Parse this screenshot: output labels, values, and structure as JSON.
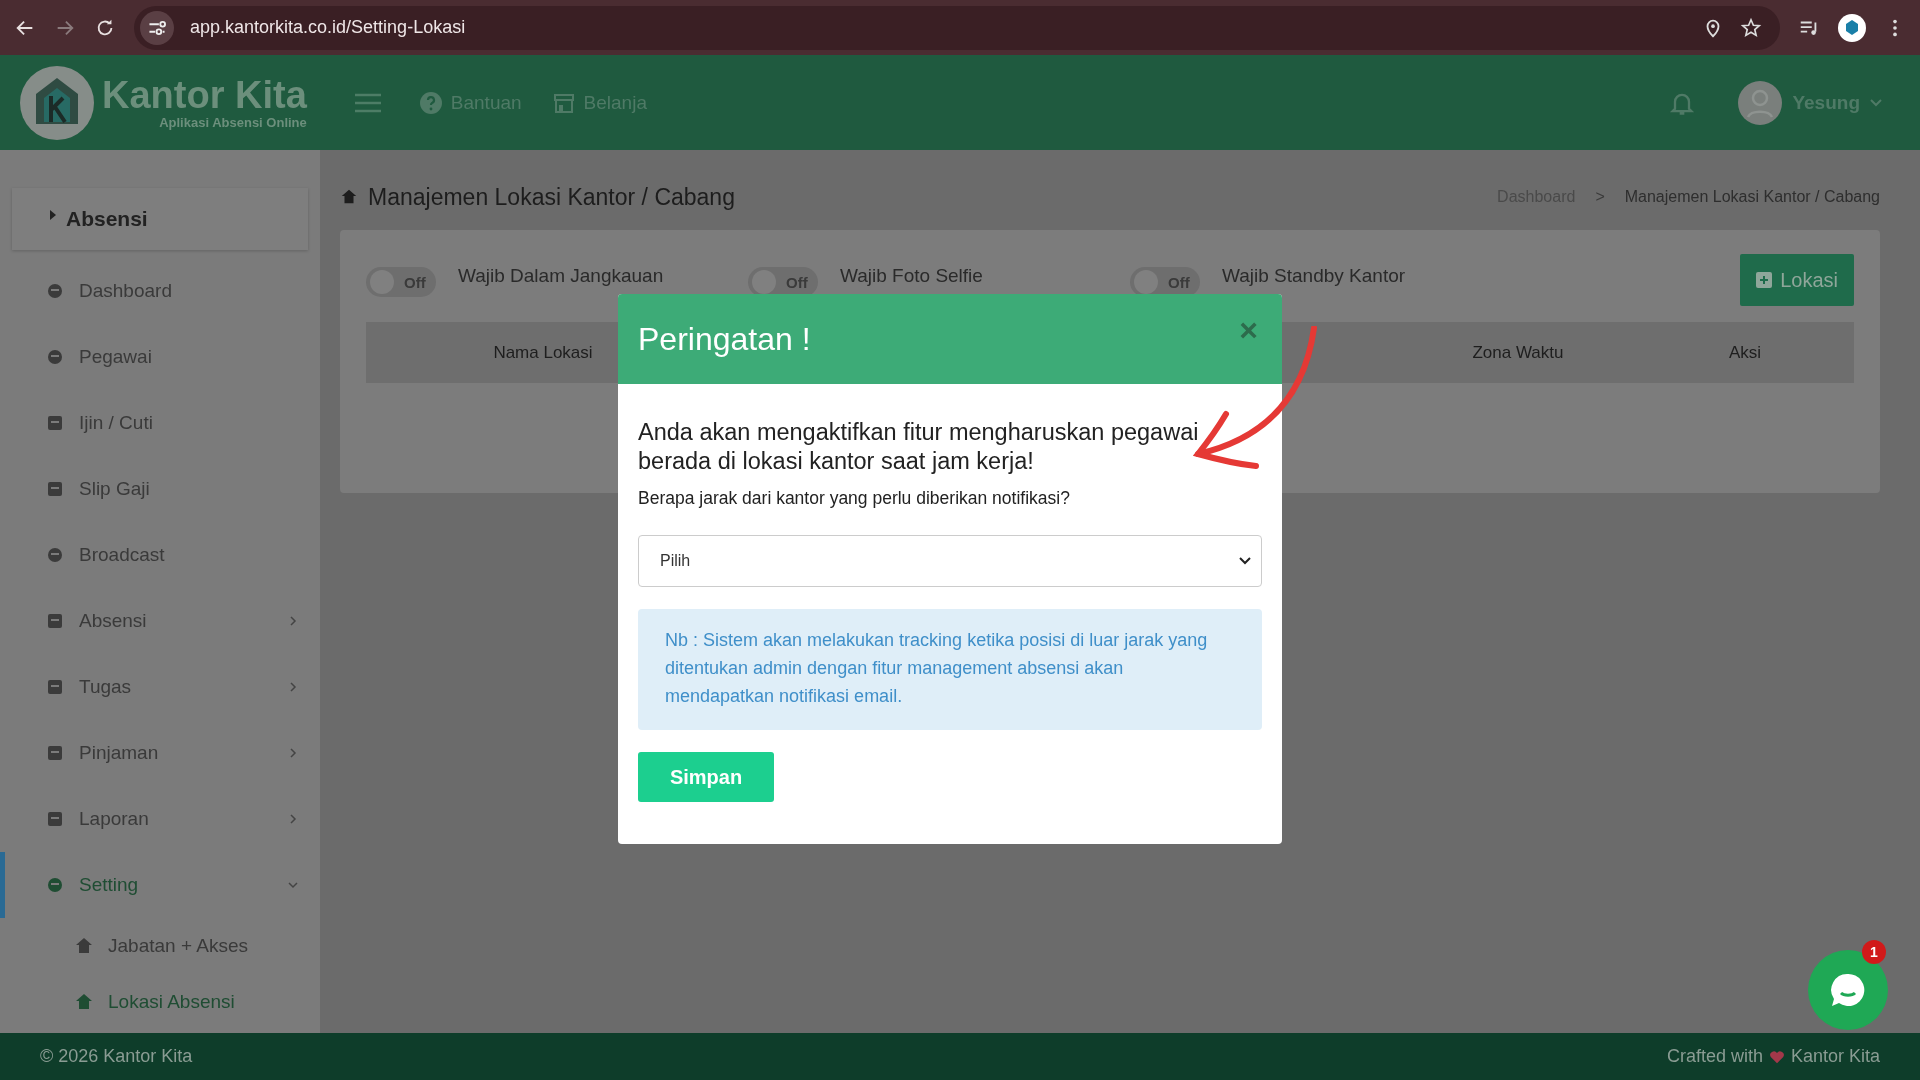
{
  "browser": {
    "url": "app.kantorkita.co.id/Setting-Lokasi"
  },
  "header": {
    "brand": "Kantor Kita",
    "tagline": "Aplikasi Absensi Online",
    "nav": [
      "Bantuan",
      "Belanja"
    ],
    "user": "Yesung"
  },
  "sidebar": {
    "section_title": "Absensi",
    "items": [
      {
        "label": "Dashboard",
        "kind": "link",
        "selected": false
      },
      {
        "label": "Pegawai",
        "kind": "link",
        "selected": false
      },
      {
        "label": "Ijin / Cuti",
        "kind": "link",
        "selected": false
      },
      {
        "label": "Slip Gaji",
        "kind": "link",
        "selected": false
      },
      {
        "label": "Broadcast",
        "kind": "link",
        "selected": false
      },
      {
        "label": "Absensi",
        "kind": "group",
        "expanded": false,
        "selected": false
      },
      {
        "label": "Tugas",
        "kind": "group",
        "expanded": false,
        "selected": false
      },
      {
        "label": "Pinjaman",
        "kind": "group",
        "expanded": false,
        "selected": false
      },
      {
        "label": "Laporan",
        "kind": "group",
        "expanded": false,
        "selected": false
      },
      {
        "label": "Setting",
        "kind": "group",
        "expanded": true,
        "selected": true,
        "children": [
          {
            "label": "Jabatan + Akses",
            "selected": false
          },
          {
            "label": "Lokasi Absensi",
            "selected": true
          }
        ]
      }
    ]
  },
  "page": {
    "title": "Manajemen Lokasi Kantor / Cabang",
    "breadcrumb": [
      "Dashboard",
      "Manajemen Lokasi Kantor / Cabang"
    ],
    "breadcrumb_separator": ">",
    "toggles": [
      {
        "label": "Wajib Dalam Jangkauan",
        "state_text": "Off",
        "on": false
      },
      {
        "label": "Wajib Foto Selfie",
        "state_text": "Off",
        "on": false
      },
      {
        "label": "Wajib Standby Kantor",
        "state_text": "Off",
        "on": false
      }
    ],
    "add_button": "Lokasi",
    "table": {
      "columns": [
        "Nama Lokasi",
        "Zona Waktu",
        "Aksi"
      ]
    }
  },
  "modal": {
    "title": "Peringatan !",
    "close": "×",
    "message": "Anda akan mengaktifkan fitur mengharuskan pegawai berada di lokasi kantor saat jam kerja!",
    "question": "Berapa jarak dari kantor yang perlu diberikan notifikasi?",
    "select_value": "Pilih",
    "note": "Nb : Sistem akan melakukan tracking ketika posisi di luar jarak yang ditentukan admin dengan fitur management absensi akan mendapatkan notifikasi email.",
    "button": "Simpan"
  },
  "footer": {
    "copyright": "© 2026 Kantor Kita",
    "credit_before": "Crafted with",
    "credit_after": "Kantor Kita"
  },
  "chat": {
    "badge": "1"
  }
}
